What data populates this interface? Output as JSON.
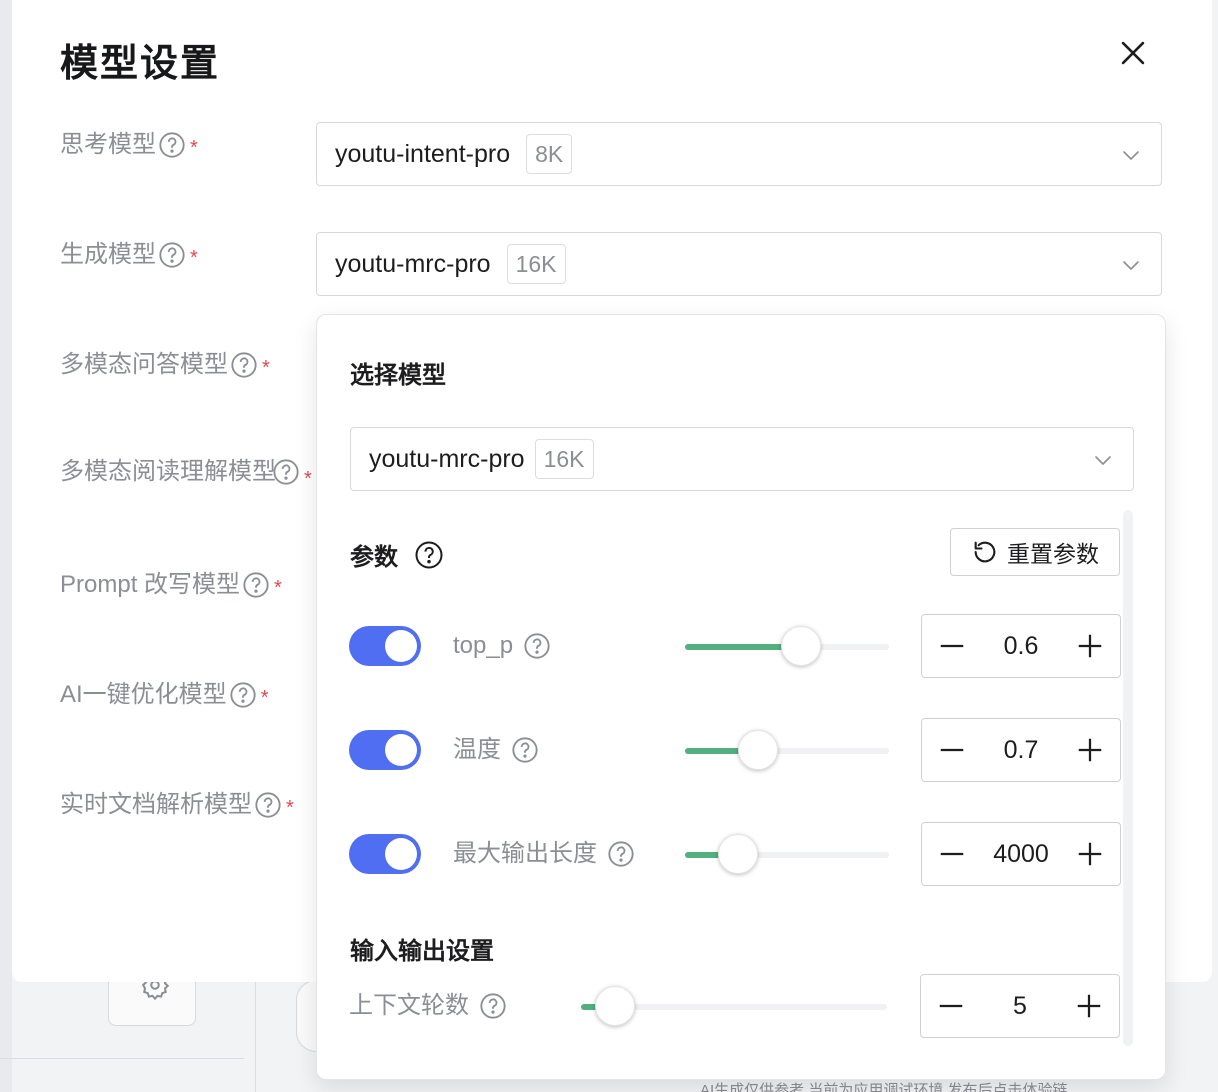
{
  "modal": {
    "title": "模型设置",
    "fields": [
      {
        "label": "思考模型"
      },
      {
        "label": "生成模型"
      },
      {
        "label": "多模态问答模型"
      },
      {
        "label": "多模态阅读理解模型"
      },
      {
        "label": "Prompt 改写模型"
      },
      {
        "label": "AI一键优化模型"
      },
      {
        "label": "实时文档解析模型"
      }
    ],
    "thinking_select": {
      "name": "youtu-intent-pro",
      "ctx": "8K"
    },
    "generation_select": {
      "name": "youtu-mrc-pro",
      "ctx": "16K"
    },
    "required_mark": "*"
  },
  "popover": {
    "title": "选择模型",
    "select": {
      "name": "youtu-mrc-pro",
      "ctx": "16K"
    },
    "params_title": "参数",
    "reset_label": "重置参数",
    "params": [
      {
        "label": "top_p",
        "value": "0.6",
        "fraction": 0.57,
        "enabled": true
      },
      {
        "label": "温度",
        "value": "0.7",
        "fraction": 0.36,
        "enabled": true
      },
      {
        "label": "最大输出长度",
        "value": "4000",
        "fraction": 0.26,
        "enabled": true
      }
    ],
    "io_title": "输入输出设置",
    "context_rounds": {
      "label": "上下文轮数",
      "value": "5",
      "fraction": 0.11
    }
  },
  "background": {
    "footer_text": "AI生成仅供参考 当前为应用调试环境 发布后点击体验链"
  },
  "colors": {
    "accent": "#4f6ef2",
    "slider_fill": "#52b07e",
    "required": "#e5484d"
  }
}
